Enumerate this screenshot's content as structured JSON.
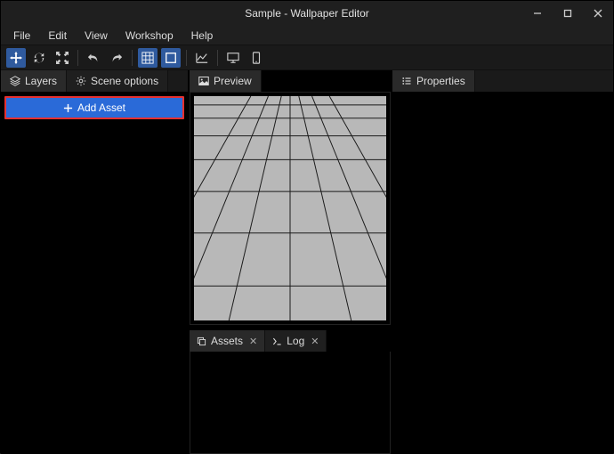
{
  "window": {
    "title": "Sample - Wallpaper Editor"
  },
  "menu": {
    "file": "File",
    "edit": "Edit",
    "view": "View",
    "workshop": "Workshop",
    "help": "Help"
  },
  "leftPanel": {
    "tabs": {
      "layers": "Layers",
      "sceneOptions": "Scene options"
    },
    "addAsset": "Add Asset"
  },
  "centerPanel": {
    "previewTab": "Preview",
    "assetsTab": "Assets",
    "logTab": "Log"
  },
  "rightPanel": {
    "propertiesTab": "Properties"
  }
}
